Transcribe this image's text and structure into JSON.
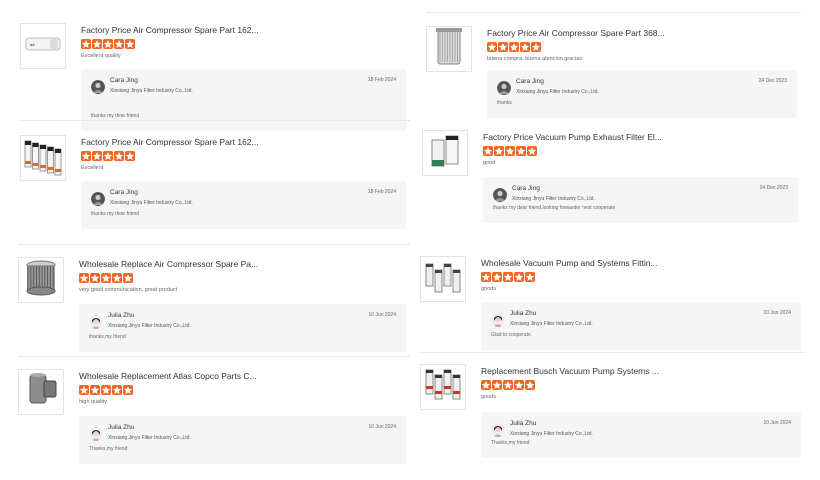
{
  "reviews": [
    {
      "product_title": "Factory Price Air Compressor Spare Part 162...",
      "rating": 5,
      "comment": "Excellent quality",
      "reply": {
        "name": "Cara Jing",
        "company": "Xinxiang Jinyu Filter Industry Co.,Ltd.",
        "date": "18 Feb 2024",
        "text": "thanks my dear friend"
      },
      "icon": "air-filter-cylinder-icon"
    },
    {
      "product_title": "Factory Price Air Compressor Spare Part 368...",
      "rating": 5,
      "comment": "buena compra, buena atencion  gracias",
      "reply": {
        "name": "Cara Jing",
        "company": "Xinxiang Jinyu Filter Industry Co.,Ltd.",
        "date": "24 Dec 2023",
        "text": "thanks"
      },
      "icon": "filter-element-icon"
    },
    {
      "product_title": "Factory Price Air Compressor Spare Part 162...",
      "rating": 5,
      "comment": "Excellent",
      "reply": {
        "name": "Cara Jing",
        "company": "Xinxiang Jinyu Filter Industry Co.,Ltd.",
        "date": "18 Feb 2024",
        "text": "thanks my dear friend"
      },
      "icon": "filter-set-icon"
    },
    {
      "product_title": "Factory Price Vacuum Pump Exhaust Filter El...",
      "rating": 5,
      "comment": "good",
      "reply": {
        "name": "Cara Jing",
        "company": "Xinxiang Jinyu Filter Industry Co.,Ltd.",
        "date": "24 Dec 2023",
        "text": "thanks my dear friend,looking forwarder next cooperate"
      },
      "icon": "exhaust-filter-icon"
    },
    {
      "product_title": "Wholesale Replace Air Compressor Spare Pa...",
      "rating": 5,
      "comment": "very good communication, great product",
      "reply": {
        "name": "Julia Zhu",
        "company": "Xinxiang Jinyu Filter Industry Co.,Ltd.",
        "date": "10 Jun 2024",
        "text": "thanks,my friend"
      },
      "icon": "pleated-filter-icon"
    },
    {
      "product_title": "Wholesale Vacuum Pump and Systems Fittin...",
      "rating": 5,
      "comment": "goods",
      "reply": {
        "name": "Julia Zhu",
        "company": "Xinxiang Jinyu Filter Industry Co.,Ltd.",
        "date": "10 Jun 2024",
        "text": "Glad to cooperate."
      },
      "icon": "filter-group-icon"
    },
    {
      "product_title": "Wholesale Replacement Atlas Copco Parts C...",
      "rating": 5,
      "comment": "high quality",
      "reply": {
        "name": "Julia Zhu",
        "company": "Xinxiang Jinyu Filter Industry Co.,Ltd.",
        "date": "10 Jun 2024",
        "text": "Thanks,my friend"
      },
      "icon": "separator-filter-icon"
    },
    {
      "product_title": "Replacement Busch Vacuum Pump Systems ...",
      "rating": 5,
      "comment": "goods",
      "reply": {
        "name": "Julia Zhu",
        "company": "Xinxiang Jinyu Filter Industry Co.,Ltd.",
        "date": "10 Jun 2024",
        "text": "Thanks,my friend"
      },
      "icon": "filter-kit-icon"
    }
  ],
  "colors": {
    "star": "#f26522",
    "reply_bg": "#f5f5f5",
    "separator": "#e8e8e8"
  }
}
